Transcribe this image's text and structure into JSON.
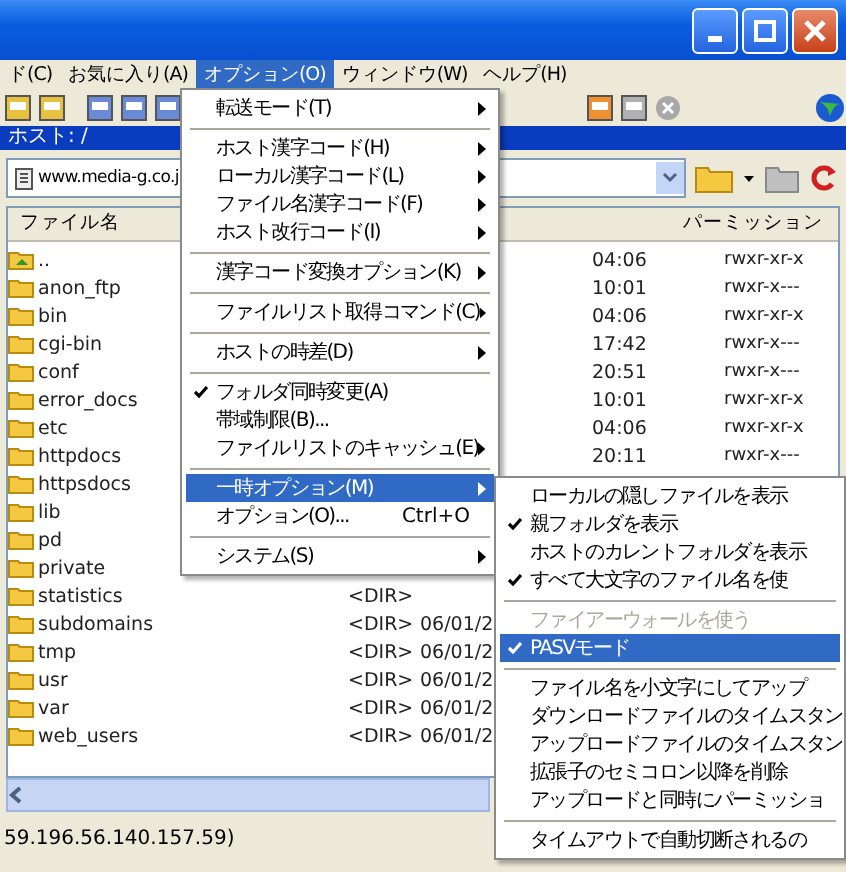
{
  "menubar": [
    {
      "label": "ド(C)",
      "selected": false
    },
    {
      "label": "お気に入り(A)",
      "selected": false
    },
    {
      "label": "オプション(O)",
      "selected": true
    },
    {
      "label": "ウィンドウ(W)",
      "selected": false
    },
    {
      "label": "ヘルプ(H)",
      "selected": false
    }
  ],
  "host_bar": "ホスト: /",
  "address": "www.media-g.co.j",
  "columns": [
    "ファイル名",
    "パーミッション"
  ],
  "rows": [
    {
      "name": "..",
      "kind": "up",
      "size": "",
      "date": "",
      "time": "04:06",
      "permission": "rwxr-xr-x"
    },
    {
      "name": "anon_ftp",
      "kind": "folder",
      "size": "",
      "date": "",
      "time": "10:01",
      "permission": "rwxr-x---"
    },
    {
      "name": "bin",
      "kind": "folder",
      "size": "",
      "date": "",
      "time": "04:06",
      "permission": "rwxr-xr-x"
    },
    {
      "name": "cgi-bin",
      "kind": "folder",
      "size": "",
      "date": "",
      "time": "17:42",
      "permission": "rwxr-x---"
    },
    {
      "name": "conf",
      "kind": "folder",
      "size": "",
      "date": "",
      "time": "20:51",
      "permission": "rwxr-x---"
    },
    {
      "name": "error_docs",
      "kind": "folder",
      "size": "",
      "date": "",
      "time": "10:01",
      "permission": "rwxr-xr-x"
    },
    {
      "name": "etc",
      "kind": "folder",
      "size": "",
      "date": "",
      "time": "04:06",
      "permission": "rwxr-xr-x"
    },
    {
      "name": "httpdocs",
      "kind": "folder",
      "size": "",
      "date": "",
      "time": "20:11",
      "permission": "rwxr-x---"
    },
    {
      "name": "httpsdocs",
      "kind": "folder",
      "size": "",
      "date": "",
      "time": "",
      "permission": ""
    },
    {
      "name": "lib",
      "kind": "folder",
      "size": "",
      "date": "",
      "time": "",
      "permission": ""
    },
    {
      "name": "pd",
      "kind": "folder",
      "size": "",
      "date": "",
      "time": "",
      "permission": ""
    },
    {
      "name": "private",
      "kind": "folder",
      "size": "",
      "date": "",
      "time": "",
      "permission": ""
    },
    {
      "name": "statistics",
      "kind": "folder",
      "size": "<DIR>",
      "date": "",
      "time": "",
      "permission": ""
    },
    {
      "name": "subdomains",
      "kind": "folder",
      "size": "<DIR>",
      "date": "06/01/2",
      "time": "",
      "permission": ""
    },
    {
      "name": "tmp",
      "kind": "folder",
      "size": "<DIR>",
      "date": "06/01/2",
      "time": "",
      "permission": ""
    },
    {
      "name": "usr",
      "kind": "folder",
      "size": "<DIR>",
      "date": "06/01/2",
      "time": "",
      "permission": ""
    },
    {
      "name": "var",
      "kind": "folder",
      "size": "<DIR>",
      "date": "06/01/2",
      "time": "",
      "permission": ""
    },
    {
      "name": "web_users",
      "kind": "folder",
      "size": "<DIR>",
      "date": "06/01/2",
      "time": "",
      "permission": ""
    }
  ],
  "options_menu": [
    {
      "kind": "item",
      "label": "転送モード(T)",
      "checked": false,
      "selected": false,
      "submenu": true
    },
    {
      "kind": "separator"
    },
    {
      "kind": "item",
      "label": "ホスト漢字コード(H)",
      "checked": false,
      "selected": false,
      "submenu": true
    },
    {
      "kind": "item",
      "label": "ローカル漢字コード(L)",
      "checked": false,
      "selected": false,
      "submenu": true
    },
    {
      "kind": "item",
      "label": "ファイル名漢字コード(F)",
      "checked": false,
      "selected": false,
      "submenu": true
    },
    {
      "kind": "item",
      "label": "ホスト改行コード(I)",
      "checked": false,
      "selected": false,
      "submenu": true
    },
    {
      "kind": "separator"
    },
    {
      "kind": "item",
      "label": "漢字コード変換オプション(K)",
      "checked": false,
      "selected": false,
      "submenu": true
    },
    {
      "kind": "separator"
    },
    {
      "kind": "item",
      "label": "ファイルリスト取得コマンド(C)",
      "checked": false,
      "selected": false,
      "submenu": true
    },
    {
      "kind": "separator"
    },
    {
      "kind": "item",
      "label": "ホストの時差(D)",
      "checked": false,
      "selected": false,
      "submenu": true
    },
    {
      "kind": "separator"
    },
    {
      "kind": "item",
      "label": "フォルダ同時変更(A)",
      "checked": true,
      "selected": false,
      "submenu": false
    },
    {
      "kind": "item",
      "label": "帯域制限(B)...",
      "checked": false,
      "selected": false,
      "submenu": false
    },
    {
      "kind": "item",
      "label": "ファイルリストのキャッシュ(E)",
      "checked": false,
      "selected": false,
      "submenu": true
    },
    {
      "kind": "separator"
    },
    {
      "kind": "item",
      "label": "一時オプション(M)",
      "checked": false,
      "selected": true,
      "submenu": true
    },
    {
      "kind": "item",
      "label": "オプション(O)...",
      "shortcut": "Ctrl+O",
      "checked": false,
      "selected": false,
      "submenu": false
    },
    {
      "kind": "separator"
    },
    {
      "kind": "item",
      "label": "システム(S)",
      "checked": false,
      "selected": false,
      "submenu": true
    }
  ],
  "temp_submenu": [
    {
      "kind": "item",
      "label": "ローカルの隠しファイルを表示",
      "checked": false,
      "selected": false,
      "disabled": false
    },
    {
      "kind": "item",
      "label": "親フォルダを表示",
      "checked": true,
      "selected": false,
      "disabled": false
    },
    {
      "kind": "item",
      "label": "ホストのカレントフォルダを表示",
      "checked": false,
      "selected": false,
      "disabled": false
    },
    {
      "kind": "item",
      "label": "すべて大文字のファイル名を使",
      "checked": true,
      "selected": false,
      "disabled": false
    },
    {
      "kind": "separator"
    },
    {
      "kind": "item",
      "label": "ファイアーウォールを使う",
      "checked": false,
      "selected": false,
      "disabled": true
    },
    {
      "kind": "item",
      "label": "PASVモード",
      "checked": true,
      "selected": true,
      "disabled": false
    },
    {
      "kind": "separator"
    },
    {
      "kind": "item",
      "label": "ファイル名を小文字にしてアップ",
      "checked": false,
      "selected": false,
      "disabled": false
    },
    {
      "kind": "item",
      "label": "ダウンロードファイルのタイムスタン",
      "checked": false,
      "selected": false,
      "disabled": false
    },
    {
      "kind": "item",
      "label": "アップロードファイルのタイムスタン",
      "checked": false,
      "selected": false,
      "disabled": false
    },
    {
      "kind": "item",
      "label": "拡張子のセミコロン以降を削除",
      "checked": false,
      "selected": false,
      "disabled": false
    },
    {
      "kind": "item",
      "label": "アップロードと同時にパーミッショ",
      "checked": false,
      "selected": false,
      "disabled": false
    },
    {
      "kind": "separator"
    },
    {
      "kind": "item",
      "label": "タイムアウトで自動切断されるの",
      "checked": false,
      "selected": false,
      "disabled": false
    }
  ],
  "status": "59.196.56.140.157.59)"
}
